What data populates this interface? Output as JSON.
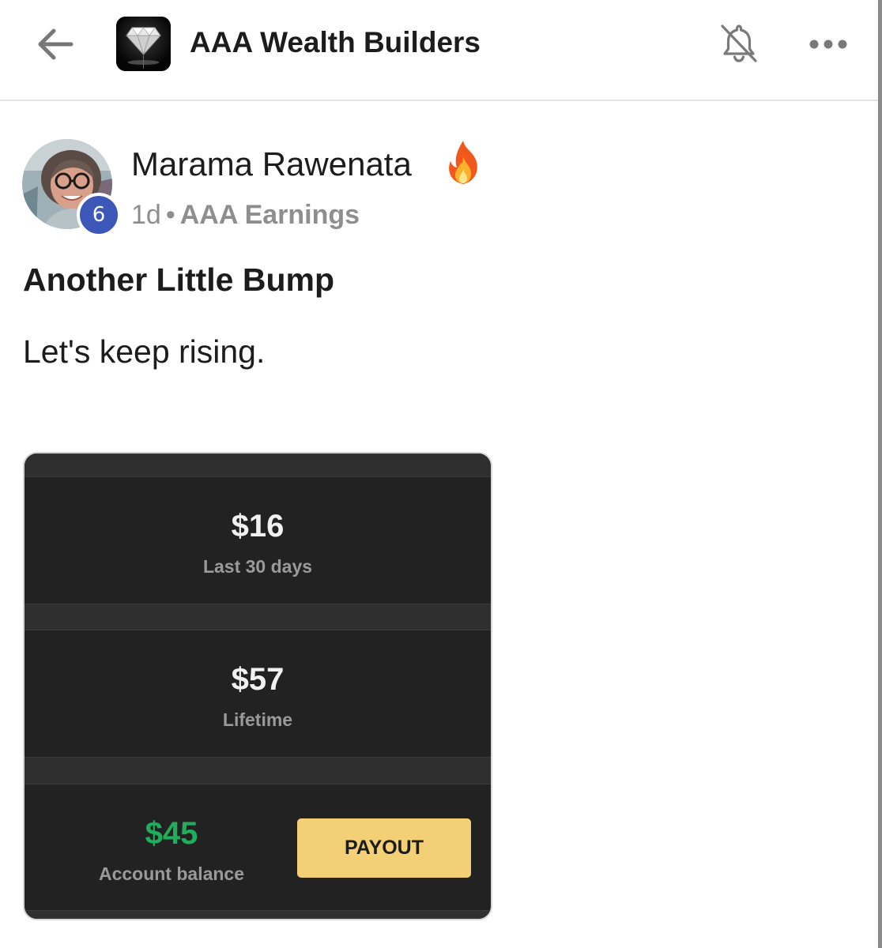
{
  "header": {
    "back_icon": "arrow-left-icon",
    "group_logo_icon": "diamond-icon",
    "group_name": "AAA Wealth Builders",
    "notifications_icon": "bell-off-icon",
    "more_icon": "more-horizontal-icon"
  },
  "post": {
    "author": {
      "name": "Marama Rawenata",
      "level": "6",
      "badge_icon": "fire-icon"
    },
    "time": "1d",
    "separator": "•",
    "category": "AAA Earnings",
    "title": "Another Little Bump",
    "body": "Let's keep rising."
  },
  "attachment": {
    "last_30_days": {
      "value": "$16",
      "label": "Last 30 days"
    },
    "lifetime": {
      "value": "$57",
      "label": "Lifetime"
    },
    "balance": {
      "value": "$45",
      "label": "Account balance"
    },
    "payout_label": "PAYOUT"
  },
  "colors": {
    "level_badge": "#3d57b8",
    "balance_green": "#1fae5c",
    "payout_button": "#f3cf75",
    "card_background": "#222222"
  }
}
